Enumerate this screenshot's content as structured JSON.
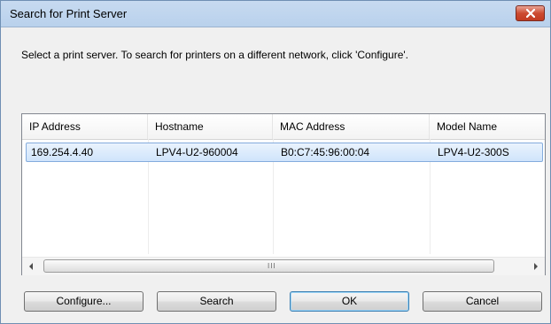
{
  "window": {
    "title": "Search for Print Server"
  },
  "instruction": "Select a print server. To search for printers on a different network, click 'Configure'.",
  "table": {
    "columns": [
      "IP Address",
      "Hostname",
      "MAC Address",
      "Model Name"
    ],
    "rows": [
      [
        "169.254.4.40",
        "LPV4-U2-960004",
        "B0:C7:45:96:00:04",
        "LPV4-U2-300S"
      ]
    ]
  },
  "scrollbar": {
    "grip": "III"
  },
  "buttons": {
    "configure": "Configure...",
    "search": "Search",
    "ok": "OK",
    "cancel": "Cancel"
  },
  "icons": [
    "close-icon",
    "scroll-left-icon",
    "scroll-right-icon"
  ]
}
